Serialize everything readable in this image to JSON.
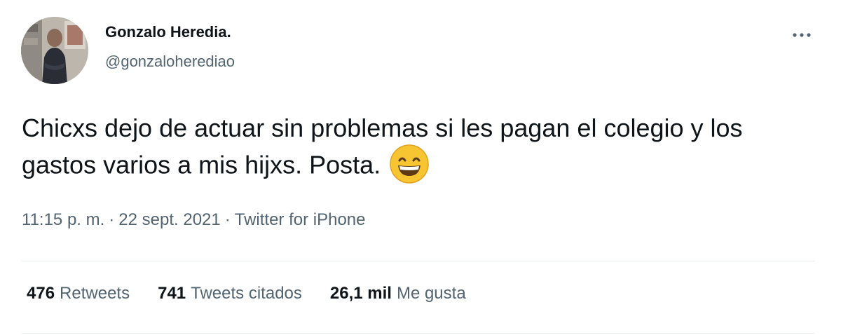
{
  "user": {
    "display_name": "Gonzalo Heredia.",
    "handle": "@gonzaloherediao",
    "avatar_icon": "profile-photo"
  },
  "menu": {
    "more_icon": "more-horizontal-icon"
  },
  "tweet": {
    "text": "Chicxs dejo de actuar sin problemas si les pagan el colegio y los gastos varios a mis hijxs. Posta.",
    "emoji_icon": "grinning-face-with-smiling-eyes-emoji"
  },
  "meta": {
    "time": "11:15 p. m.",
    "separator": "·",
    "date": "22 sept. 2021",
    "source": "Twitter for iPhone"
  },
  "stats": {
    "retweets_count": "476",
    "retweets_label": "Retweets",
    "quotes_count": "741",
    "quotes_label": "Tweets citados",
    "likes_count": "26,1 mil",
    "likes_label": "Me gusta"
  },
  "colors": {
    "text_primary": "#0f1419",
    "text_secondary": "#536471",
    "divider": "#e6ecf0",
    "emoji_yellow": "#f7c531"
  }
}
